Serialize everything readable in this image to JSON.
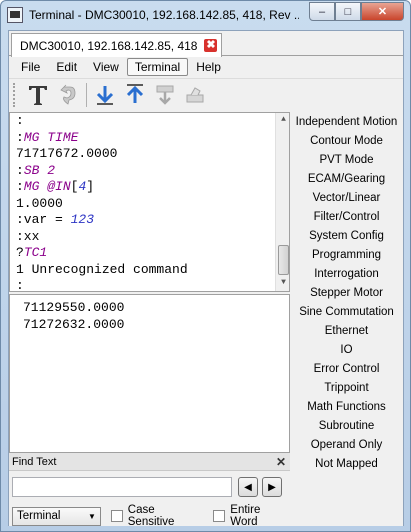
{
  "window": {
    "title": "Terminal - DMC30010, 192.168.142.85, 418, Rev ...",
    "min_glyph": "–",
    "max_glyph": "□",
    "close_glyph": "✕"
  },
  "tab": {
    "label": "DMC30010, 192.168.142.85, 418",
    "close_glyph": "✖"
  },
  "menu": {
    "items": [
      "File",
      "Edit",
      "View",
      "Terminal",
      "Help"
    ]
  },
  "toolbar": {
    "icons": [
      "text-font-icon",
      "undo-icon",
      "download-icon",
      "upload-icon",
      "download-disabled-icon",
      "eraser-icon"
    ]
  },
  "terminal": {
    "lines": [
      {
        "parts": [
          {
            "t": ":",
            "c": ""
          }
        ]
      },
      {
        "parts": [
          {
            "t": ":",
            "c": ""
          },
          {
            "t": "MG TIME",
            "c": "kw"
          }
        ]
      },
      {
        "parts": [
          {
            "t": "71717672.0000",
            "c": ""
          }
        ]
      },
      {
        "parts": [
          {
            "t": ":",
            "c": ""
          },
          {
            "t": "SB 2",
            "c": "kw"
          }
        ]
      },
      {
        "parts": [
          {
            "t": ":",
            "c": ""
          },
          {
            "t": "MG",
            "c": "kw"
          },
          {
            "t": " ",
            "c": ""
          },
          {
            "t": "@IN",
            "c": "kw"
          },
          {
            "t": "[",
            "c": ""
          },
          {
            "t": "4",
            "c": "num"
          },
          {
            "t": "]",
            "c": ""
          }
        ]
      },
      {
        "parts": [
          {
            "t": "1.0000",
            "c": ""
          }
        ]
      },
      {
        "parts": [
          {
            "t": ":var = ",
            "c": ""
          },
          {
            "t": "123",
            "c": "num"
          }
        ]
      },
      {
        "parts": [
          {
            "t": ":xx",
            "c": ""
          }
        ]
      },
      {
        "parts": [
          {
            "t": "?",
            "c": ""
          },
          {
            "t": "TC1",
            "c": "kw"
          }
        ]
      },
      {
        "parts": [
          {
            "t": "1 Unrecognized command",
            "c": ""
          }
        ]
      },
      {
        "parts": [
          {
            "t": ":",
            "c": ""
          }
        ]
      }
    ]
  },
  "command_output": [
    "71129550.0000",
    "71272632.0000"
  ],
  "categories": [
    "Independent Motion",
    "Contour Mode",
    "PVT Mode",
    "ECAM/Gearing",
    "Vector/Linear",
    "Filter/Control",
    "System Config",
    "Programming",
    "Interrogation",
    "Stepper Motor",
    "Sine Commutation",
    "Ethernet",
    "IO",
    "Error Control",
    "Trippoint",
    "Math Functions",
    "Subroutine",
    "Operand Only",
    "Not Mapped"
  ],
  "find": {
    "header": "Find Text",
    "close_glyph": "✕",
    "input_value": "",
    "prev_glyph": "◀",
    "next_glyph": "▶",
    "scope_selected": "Terminal",
    "case_sensitive_label": "Case Sensitive",
    "entire_word_label": "Entire Word"
  }
}
